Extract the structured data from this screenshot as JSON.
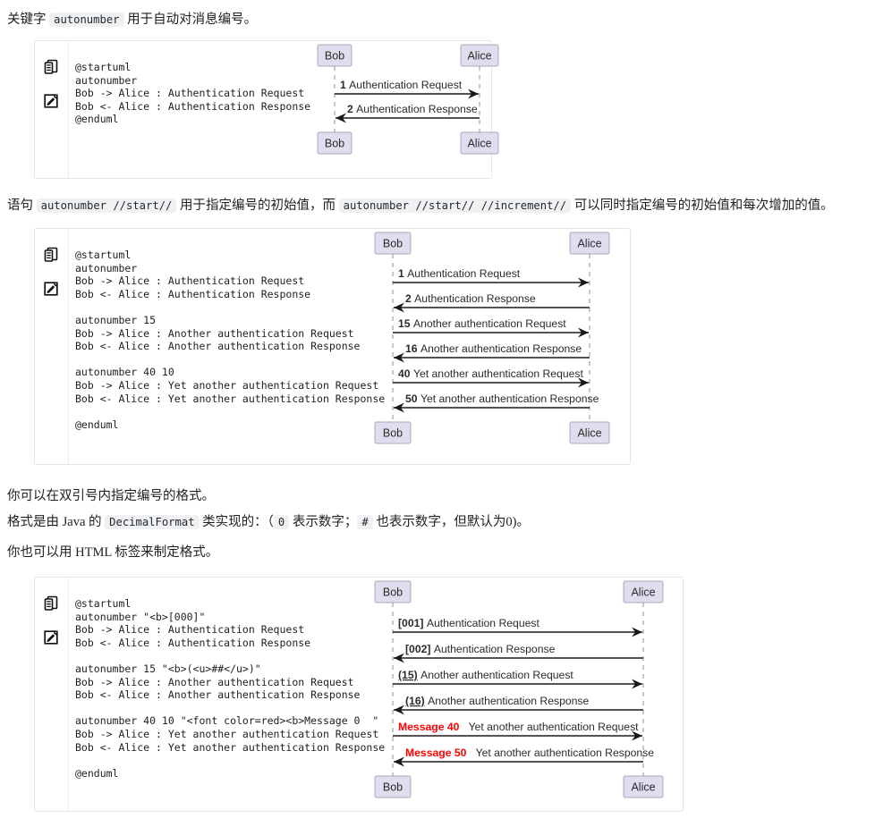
{
  "doc": {
    "paragraphs": [
      {
        "id": "p-intro",
        "parts": [
          {
            "t": "text",
            "v": "关键字 "
          },
          {
            "t": "code",
            "v": "autonumber"
          },
          {
            "t": "text",
            "v": " 用于自动对消息编号。"
          }
        ]
      },
      {
        "id": "p-start-increment",
        "parts": [
          {
            "t": "text",
            "v": "语句 "
          },
          {
            "t": "code",
            "v": "autonumber //start//"
          },
          {
            "t": "text",
            "v": " 用于指定编号的初始值，而 "
          },
          {
            "t": "code",
            "v": "autonumber //start// //increment//"
          },
          {
            "t": "text",
            "v": " 可以同时指定编号的初始值和每次增加的值。"
          }
        ]
      },
      {
        "id": "p-quote-format",
        "parts": [
          {
            "t": "text",
            "v": "你可以在双引号内指定编号的格式。"
          }
        ]
      },
      {
        "id": "p-decimalformat",
        "parts": [
          {
            "t": "text",
            "v": "格式是由 Java 的 "
          },
          {
            "t": "code",
            "v": "DecimalFormat"
          },
          {
            "t": "text",
            "v": " 类实现的：（"
          },
          {
            "t": "code",
            "v": "0"
          },
          {
            "t": "text",
            "v": " 表示数字；"
          },
          {
            "t": "code",
            "v": "#"
          },
          {
            "t": "text",
            "v": " 也表示数字，但默认为0)。"
          }
        ]
      },
      {
        "id": "p-html-tags",
        "parts": [
          {
            "t": "text",
            "v": "你也可以用 HTML 标签来制定格式。"
          }
        ]
      }
    ],
    "icons": {
      "copy": "copy-icon",
      "edit": "edit-icon"
    },
    "blocks": [
      {
        "id": "block-1",
        "code": "@startuml\nautonumber\nBob -> Alice : Authentication Request\nBob <- Alice : Authentication Response\n@enduml",
        "diagram": {
          "participants": [
            "Bob",
            "Alice"
          ],
          "messages": [
            {
              "num": "1",
              "text": "Authentication Request",
              "dir": "right",
              "numStyle": "bold"
            },
            {
              "num": "2",
              "text": "Authentication Response",
              "dir": "left",
              "numStyle": "bold"
            }
          ]
        }
      },
      {
        "id": "block-2",
        "code": "@startuml\nautonumber\nBob -> Alice : Authentication Request\nBob <- Alice : Authentication Response\n\nautonumber 15\nBob -> Alice : Another authentication Request\nBob <- Alice : Another authentication Response\n\nautonumber 40 10\nBob -> Alice : Yet another authentication Request\nBob <- Alice : Yet another authentication Response\n\n@enduml",
        "diagram": {
          "participants": [
            "Bob",
            "Alice"
          ],
          "messages": [
            {
              "num": "1",
              "text": "Authentication Request",
              "dir": "right",
              "numStyle": "bold"
            },
            {
              "num": "2",
              "text": "Authentication Response",
              "dir": "left",
              "numStyle": "bold"
            },
            {
              "num": "15",
              "text": "Another authentication Request",
              "dir": "right",
              "numStyle": "bold"
            },
            {
              "num": "16",
              "text": "Another authentication Response",
              "dir": "left",
              "numStyle": "bold"
            },
            {
              "num": "40",
              "text": "Yet another authentication Request",
              "dir": "right",
              "numStyle": "bold"
            },
            {
              "num": "50",
              "text": "Yet another authentication Response",
              "dir": "left",
              "numStyle": "bold"
            }
          ]
        }
      },
      {
        "id": "block-3",
        "code": "@startuml\nautonumber \"<b>[000]\"\nBob -> Alice : Authentication Request\nBob <- Alice : Authentication Response\n\nautonumber 15 \"<b>(<u>##</u>)\"\nBob -> Alice : Another authentication Request\nBob <- Alice : Another authentication Response\n\nautonumber 40 10 \"<font color=red><b>Message 0  \"\nBob -> Alice : Yet another authentication Request\nBob <- Alice : Yet another authentication Response\n\n@enduml",
        "diagram": {
          "participants": [
            "Bob",
            "Alice"
          ],
          "messages": [
            {
              "num": "[001]",
              "text": "Authentication Request",
              "dir": "right",
              "numStyle": "bold"
            },
            {
              "num": "[002]",
              "text": "Authentication Response",
              "dir": "left",
              "numStyle": "bold"
            },
            {
              "num": "(15)",
              "text": "Another authentication Request",
              "dir": "right",
              "numStyle": "bold-underline"
            },
            {
              "num": "(16)",
              "text": "Another authentication Response",
              "dir": "left",
              "numStyle": "bold-underline"
            },
            {
              "num": "Message 40",
              "text": "Yet another authentication Request",
              "dir": "right",
              "numStyle": "bold-red"
            },
            {
              "num": "Message 50",
              "text": "Yet another authentication Response",
              "dir": "left",
              "numStyle": "bold-red"
            }
          ]
        }
      }
    ]
  },
  "colors": {
    "participant_fill": "#dedeee",
    "participant_border": "#a8a8c0",
    "lifeline": "#b0b0b0",
    "arrow": "#1a1a1a",
    "text": "#2b2b2b",
    "red": "#ff0000",
    "block_border": "#e3e5e8",
    "inline_code_bg": "#f0f1f3"
  }
}
